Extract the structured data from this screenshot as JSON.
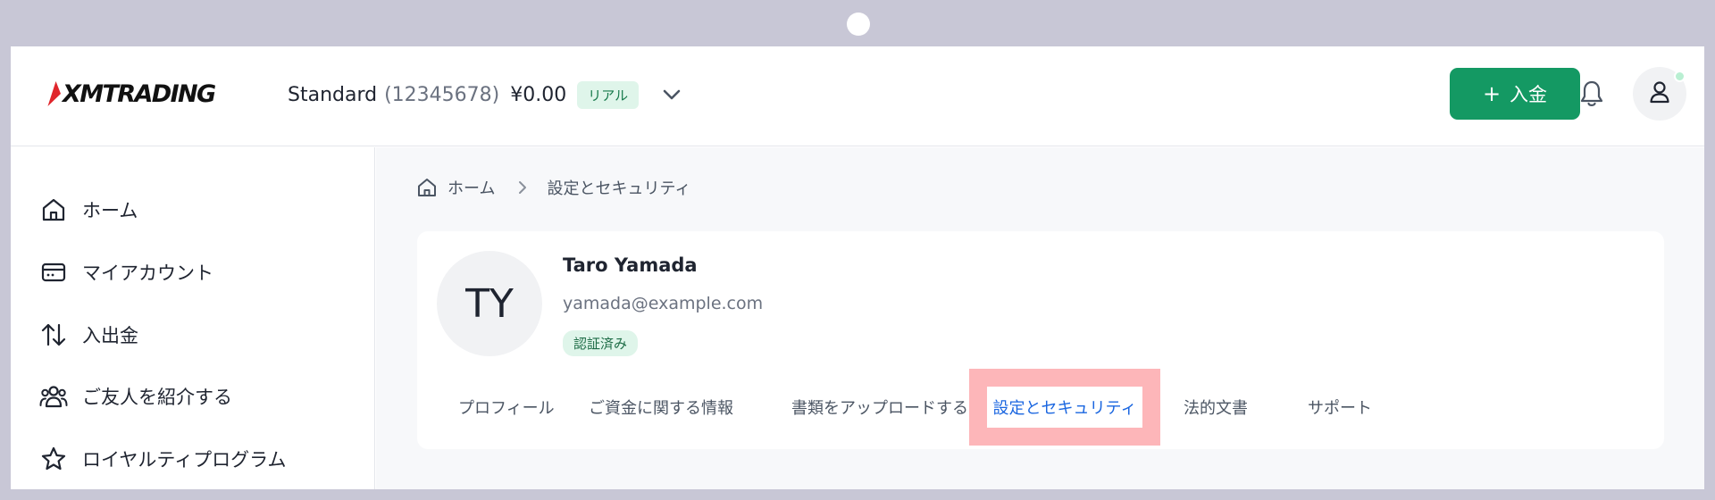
{
  "logo": {
    "text": "XMTRADING",
    "accent": "#e0252b"
  },
  "account": {
    "type": "Standard",
    "number": "(12345678)",
    "balance": "¥0.00",
    "badge": "リアル",
    "dropdown_icon": "chevron-down-icon"
  },
  "header": {
    "deposit_label": "入金",
    "deposit_icon": "plus-icon",
    "notifications_icon": "bell-icon",
    "profile_icon": "user-icon",
    "brand_green": "#149963"
  },
  "sidebar": {
    "items": [
      {
        "label": "ホーム",
        "icon": "home-icon"
      },
      {
        "label": "マイアカウント",
        "icon": "credit-card-icon"
      },
      {
        "label": "入出金",
        "icon": "transfer-arrows-icon"
      },
      {
        "label": "ご友人を紹介する",
        "icon": "users-icon"
      },
      {
        "label": "ロイヤルティプログラム",
        "icon": "star-icon"
      }
    ]
  },
  "breadcrumb": {
    "home": "ホーム",
    "current": "設定とセキュリティ"
  },
  "profile": {
    "initials": "TY",
    "name": "Taro Yamada",
    "email": "yamada@example.com",
    "status": "認証済み"
  },
  "tabs": [
    {
      "label": "プロフィール"
    },
    {
      "label": "ご資金に関する情報"
    },
    {
      "label": "書類をアップロードする"
    },
    {
      "label": "設定とセキュリティ",
      "active": true
    },
    {
      "label": "法的文書"
    },
    {
      "label": "サポート"
    }
  ],
  "colors": {
    "active_tab_text": "#1a66e0",
    "active_tab_highlight": "#fdb6b9",
    "badge_bg": "#dff5ea"
  }
}
